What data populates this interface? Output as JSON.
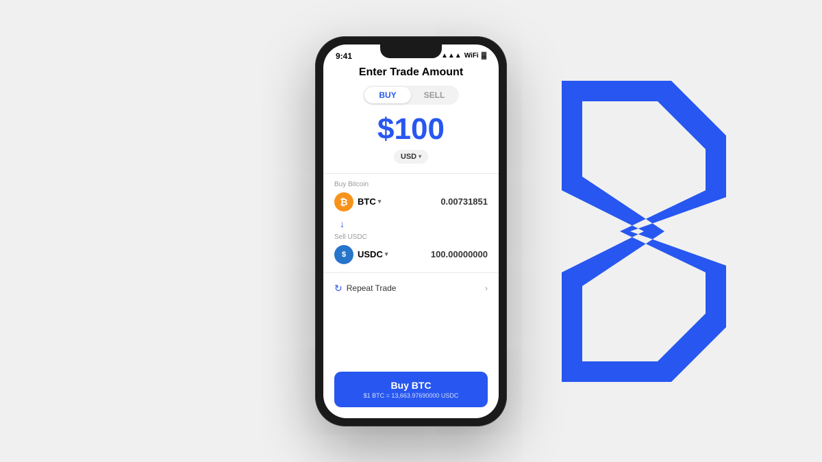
{
  "background": {
    "color": "#f0f0f0"
  },
  "status_bar": {
    "time": "9:41",
    "icons": "●●●"
  },
  "screen": {
    "title": "Enter Trade Amount",
    "toggle": {
      "buy_label": "BUY",
      "sell_label": "SELL",
      "active": "buy"
    },
    "amount": "$100",
    "currency": {
      "selected": "USD",
      "dropdown_icon": "▾"
    },
    "buy_section": {
      "label": "Buy Bitcoin",
      "coin_symbol": "BTC",
      "coin_value": "0.00731851",
      "icon_label": "₿"
    },
    "sell_section": {
      "label": "Sell USDC",
      "coin_symbol": "USDC",
      "coin_value": "100.00000000",
      "icon_label": "$"
    },
    "repeat_trade": {
      "label": "Repeat Trade"
    },
    "buy_button": {
      "label": "Buy BTC",
      "sub_label": "$1 BTC = 13,663.97690000 USDC"
    }
  }
}
